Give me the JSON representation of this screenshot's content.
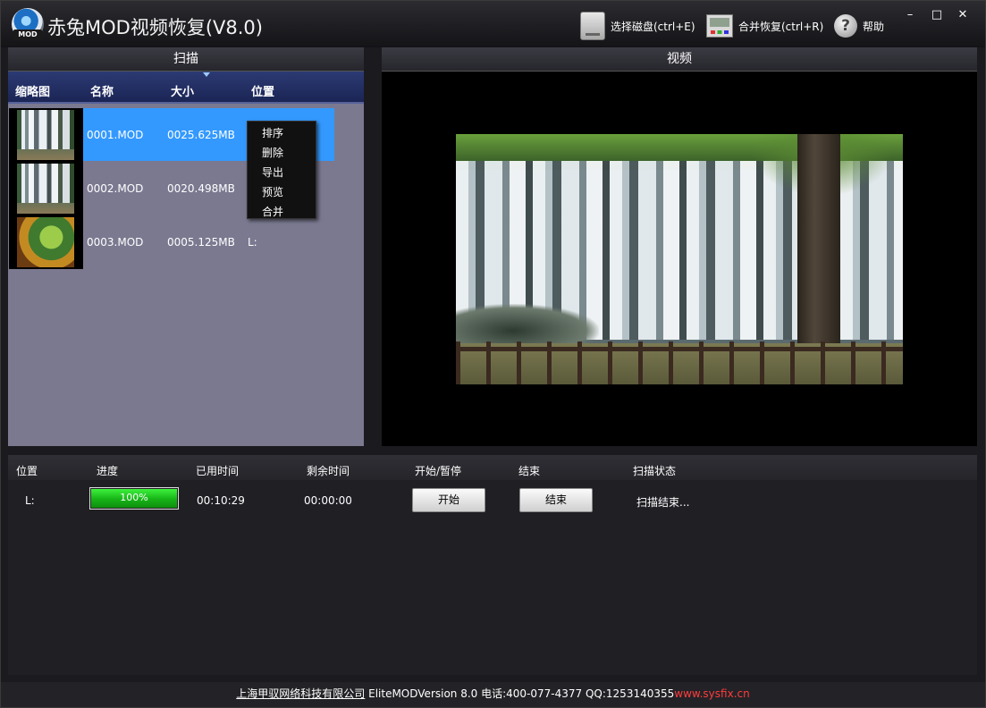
{
  "app": {
    "logo_text": "MOD",
    "title": "赤兔MOD视频恢复(V8.0)"
  },
  "toolbar": {
    "select_disk": "选择磁盘(ctrl+E)",
    "merge_restore": "合并恢复(ctrl+R)",
    "help": "帮助",
    "help_glyph": "?"
  },
  "window_controls": {
    "minimize": "–",
    "maximize": "□",
    "close": "✕"
  },
  "scan_panel": {
    "header": "扫描",
    "columns": {
      "thumbnail": "缩略图",
      "name": "名称",
      "size": "大小",
      "location": "位置"
    },
    "rows": [
      {
        "name": "0001.MOD",
        "size": "0025.625MB",
        "location": ""
      },
      {
        "name": "0002.MOD",
        "size": "0020.498MB",
        "location": ""
      },
      {
        "name": "0003.MOD",
        "size": "0005.125MB",
        "location": "L:"
      }
    ]
  },
  "context_menu": {
    "items": [
      "排序",
      "删除",
      "导出",
      "预览",
      "合并"
    ]
  },
  "video_panel": {
    "header": "视频"
  },
  "status_panel": {
    "columns": {
      "location": "位置",
      "progress": "进度",
      "elapsed": "已用时间",
      "remaining": "剩余时间",
      "start_pause": "开始/暂停",
      "end": "结束",
      "scan_status": "扫描状态"
    },
    "row": {
      "location": "L:",
      "progress_label": "100%",
      "progress_fraction": 1.0,
      "elapsed": "00:10:29",
      "remaining": "00:00:00",
      "start_button": "开始",
      "end_button": "结束",
      "scan_status": "扫描结束..."
    }
  },
  "footer": {
    "company": "上海甲驭网络科技有限公司",
    "info": " EliteMODVersion 8.0 电话:400-077-4377 QQ:1253140355",
    "url": "www.sysfix.cn"
  },
  "colors": {
    "selection": "#3399ff",
    "progress": "#16b316",
    "footer_url": "#ff3c3c"
  }
}
